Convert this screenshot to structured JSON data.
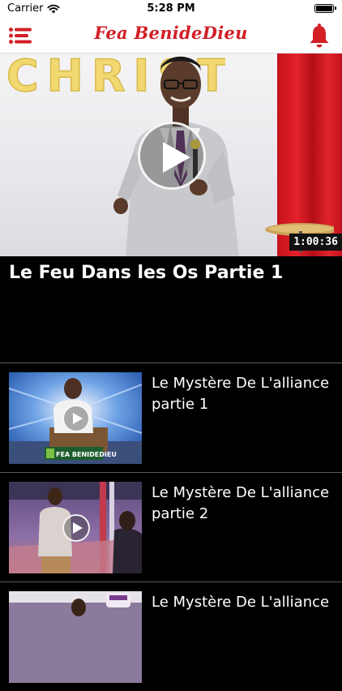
{
  "status_bar": {
    "carrier": "Carrier",
    "time": "5:28 PM"
  },
  "nav": {
    "title": "Fea BenideDieu",
    "menu_icon": "menu-lines-icon",
    "bell_icon": "bell-icon"
  },
  "featured": {
    "duration": "1:00:36",
    "title": "Le Feu Dans les Os Partie 1",
    "play_icon": "play-icon",
    "balloon_letters": "CHRIST"
  },
  "videos": [
    {
      "title": "Le Mystère De L'alliance partie 1",
      "thumb_caption": "FEA BENIDEDIEU"
    },
    {
      "title": "Le Mystère De L'alliance partie 2"
    },
    {
      "title": "Le Mystère De L'alliance"
    }
  ],
  "colors": {
    "accent": "#d21f26",
    "background": "#000000",
    "nav_background": "#ffffff",
    "text": "#ffffff"
  }
}
